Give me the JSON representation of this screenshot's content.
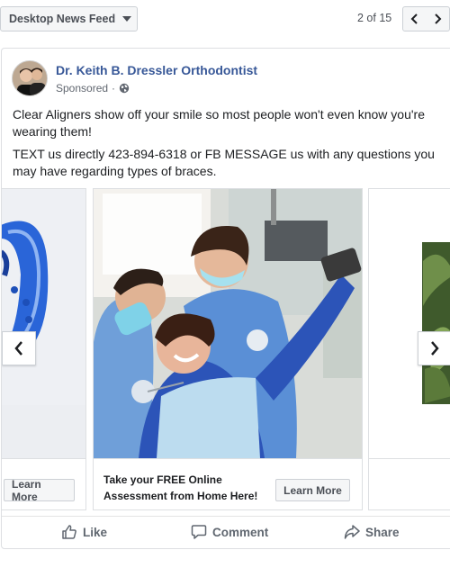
{
  "toolbar": {
    "placement": "Desktop News Feed",
    "pager": "2 of 15"
  },
  "post": {
    "page_name": "Dr. Keith B. Dressler Orthodontist",
    "sponsored": "Sponsored",
    "sponsored_separator": "·",
    "text_1": "Clear Aligners show off your smile so most people won't even know you're wearing them!",
    "text_2": "TEXT us directly 423-894-6318 or FB MESSAGE us with any questions you may have regarding types of braces."
  },
  "carousel": {
    "cards": [
      {
        "cta": "Learn More"
      },
      {
        "headline": "Take your FREE Online Assessment from Home Here!",
        "cta": "Learn More"
      },
      {}
    ]
  },
  "actions": {
    "like": "Like",
    "comment": "Comment",
    "share": "Share"
  },
  "colors": {
    "link": "#385898",
    "aligner_blue": "#2a65d8",
    "scrubs_blue": "#5a8fd6"
  }
}
